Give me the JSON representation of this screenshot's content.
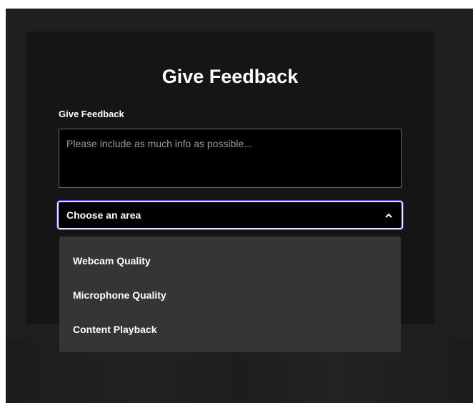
{
  "modal": {
    "title": "Give Feedback",
    "field_label": "Give Feedback",
    "feedback_placeholder": "Please include as much info as possible...",
    "feedback_value": ""
  },
  "area_select": {
    "selected_label": "Choose an area",
    "options": [
      {
        "label": "Webcam Quality"
      },
      {
        "label": "Microphone Quality"
      },
      {
        "label": "Content Playback"
      }
    ]
  },
  "colors": {
    "backdrop": "#1f1f1f",
    "modal": "#151515",
    "dropdown": "#353535",
    "focus_ring": "#3b3bd6"
  }
}
